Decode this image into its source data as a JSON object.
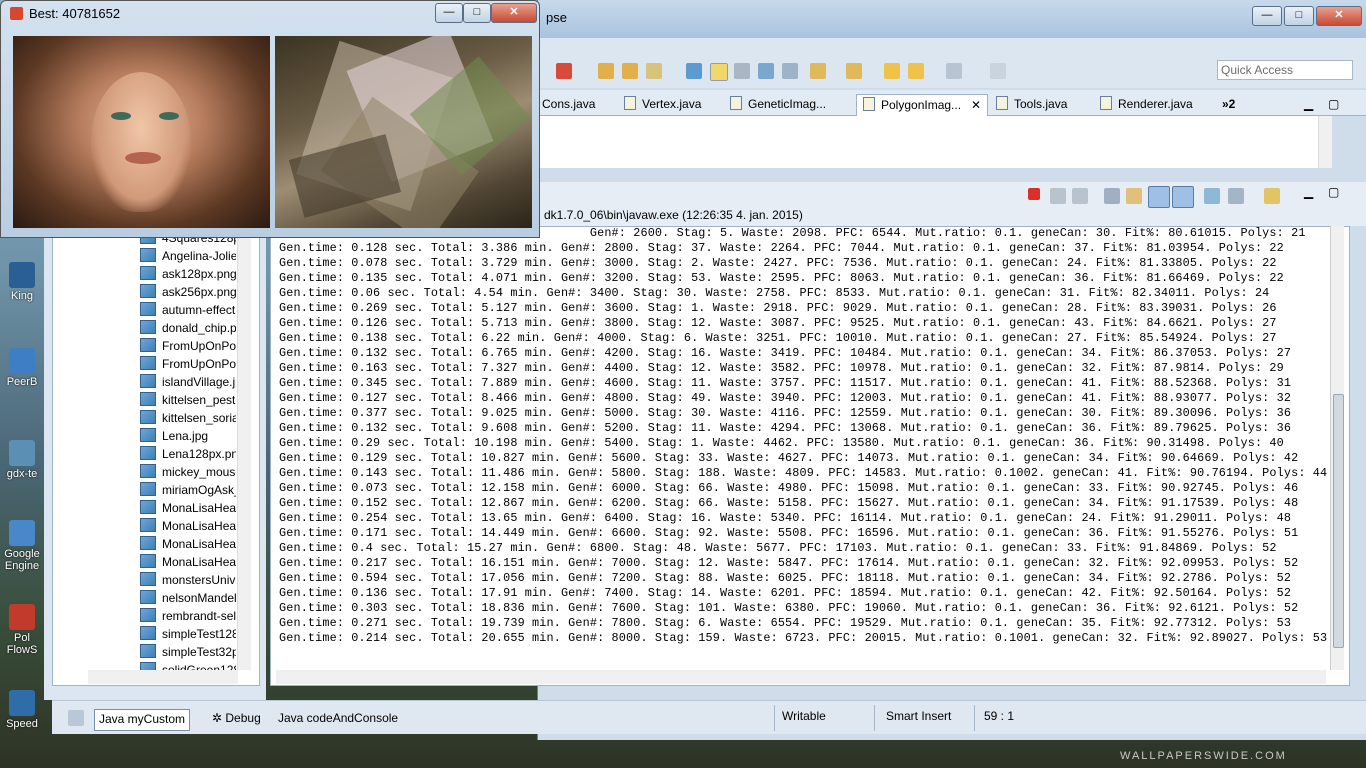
{
  "desktop": {
    "icons": [
      {
        "label": "King",
        "icon": "app-icon"
      },
      {
        "label": "PeerB",
        "icon": "app-icon"
      },
      {
        "label": "gdx-te",
        "icon": "app-icon"
      },
      {
        "label": "Google Engine",
        "icon": "app-icon"
      },
      {
        "label": "Pol FlowS",
        "icon": "app-icon"
      },
      {
        "label": "Speed",
        "icon": "app-icon"
      }
    ],
    "watermark": "WALLPAPERSWIDE.COM"
  },
  "image_window": {
    "title": "Best: 40781652",
    "buttons": {
      "minimize": "—",
      "maximize": "□",
      "close": "✕"
    }
  },
  "eclipse": {
    "title_fragment": "pse",
    "window_buttons": {
      "minimize": "—",
      "maximize": "□",
      "close": "✕"
    },
    "quick_access_placeholder": "Quick Access",
    "editor_tabs": [
      {
        "label": "Cons.java",
        "active": false
      },
      {
        "label": "Vertex.java",
        "active": false
      },
      {
        "label": "GeneticImag...",
        "active": false
      },
      {
        "label": "PolygonImag...",
        "active": true
      },
      {
        "label": "Tools.java",
        "active": false
      },
      {
        "label": "Renderer.java",
        "active": false
      }
    ],
    "tabs_overflow": "»2",
    "console_path": "dk1.7.0_06\\bin\\javaw.exe (12:26:35 4. jan. 2015)",
    "console_lines": [
      "                                           Gen#: 2600. Stag: 5. Waste: 2098. PFC: 6544. Mut.ratio: 0.1. geneCan: 30. Fit%: 80.61015. Polys: 21",
      "Gen.time: 0.128 sec. Total: 3.386 min. Gen#: 2800. Stag: 37. Waste: 2264. PFC: 7044. Mut.ratio: 0.1. geneCan: 37. Fit%: 81.03954. Polys: 22",
      "Gen.time: 0.078 sec. Total: 3.729 min. Gen#: 3000. Stag: 2. Waste: 2427. PFC: 7536. Mut.ratio: 0.1. geneCan: 24. Fit%: 81.33805. Polys: 22",
      "Gen.time: 0.135 sec. Total: 4.071 min. Gen#: 3200. Stag: 53. Waste: 2595. PFC: 8063. Mut.ratio: 0.1. geneCan: 36. Fit%: 81.66469. Polys: 22",
      "Gen.time: 0.06 sec. Total: 4.54 min. Gen#: 3400. Stag: 30. Waste: 2758. PFC: 8533. Mut.ratio: 0.1. geneCan: 31. Fit%: 82.34011. Polys: 24",
      "Gen.time: 0.269 sec. Total: 5.127 min. Gen#: 3600. Stag: 1. Waste: 2918. PFC: 9029. Mut.ratio: 0.1. geneCan: 28. Fit%: 83.39031. Polys: 26",
      "Gen.time: 0.126 sec. Total: 5.713 min. Gen#: 3800. Stag: 12. Waste: 3087. PFC: 9525. Mut.ratio: 0.1. geneCan: 43. Fit%: 84.6621. Polys: 27",
      "Gen.time: 0.138 sec. Total: 6.22 min. Gen#: 4000. Stag: 6. Waste: 3251. PFC: 10010. Mut.ratio: 0.1. geneCan: 27. Fit%: 85.54924. Polys: 27",
      "Gen.time: 0.132 sec. Total: 6.765 min. Gen#: 4200. Stag: 16. Waste: 3419. PFC: 10484. Mut.ratio: 0.1. geneCan: 34. Fit%: 86.37053. Polys: 27",
      "Gen.time: 0.163 sec. Total: 7.327 min. Gen#: 4400. Stag: 12. Waste: 3582. PFC: 10978. Mut.ratio: 0.1. geneCan: 32. Fit%: 87.9814. Polys: 29",
      "Gen.time: 0.345 sec. Total: 7.889 min. Gen#: 4600. Stag: 11. Waste: 3757. PFC: 11517. Mut.ratio: 0.1. geneCan: 41. Fit%: 88.52368. Polys: 31",
      "Gen.time: 0.127 sec. Total: 8.466 min. Gen#: 4800. Stag: 49. Waste: 3940. PFC: 12003. Mut.ratio: 0.1. geneCan: 41. Fit%: 88.93077. Polys: 32",
      "Gen.time: 0.377 sec. Total: 9.025 min. Gen#: 5000. Stag: 30. Waste: 4116. PFC: 12559. Mut.ratio: 0.1. geneCan: 30. Fit%: 89.30096. Polys: 36",
      "Gen.time: 0.132 sec. Total: 9.608 min. Gen#: 5200. Stag: 11. Waste: 4294. PFC: 13068. Mut.ratio: 0.1. geneCan: 36. Fit%: 89.79625. Polys: 36",
      "Gen.time: 0.29 sec. Total: 10.198 min. Gen#: 5400. Stag: 1. Waste: 4462. PFC: 13580. Mut.ratio: 0.1. geneCan: 36. Fit%: 90.31498. Polys: 40",
      "Gen.time: 0.129 sec. Total: 10.827 min. Gen#: 5600. Stag: 33. Waste: 4627. PFC: 14073. Mut.ratio: 0.1. geneCan: 34. Fit%: 90.64669. Polys: 42",
      "Gen.time: 0.143 sec. Total: 11.486 min. Gen#: 5800. Stag: 188. Waste: 4809. PFC: 14583. Mut.ratio: 0.1002. geneCan: 41. Fit%: 90.76194. Polys: 44",
      "Gen.time: 0.073 sec. Total: 12.158 min. Gen#: 6000. Stag: 66. Waste: 4980. PFC: 15098. Mut.ratio: 0.1. geneCan: 33. Fit%: 90.92745. Polys: 46",
      "Gen.time: 0.152 sec. Total: 12.867 min. Gen#: 6200. Stag: 66. Waste: 5158. PFC: 15627. Mut.ratio: 0.1. geneCan: 34. Fit%: 91.17539. Polys: 48",
      "Gen.time: 0.254 sec. Total: 13.65 min. Gen#: 6400. Stag: 16. Waste: 5340. PFC: 16114. Mut.ratio: 0.1. geneCan: 24. Fit%: 91.29011. Polys: 48",
      "Gen.time: 0.171 sec. Total: 14.449 min. Gen#: 6600. Stag: 92. Waste: 5508. PFC: 16596. Mut.ratio: 0.1. geneCan: 36. Fit%: 91.55276. Polys: 51",
      "Gen.time: 0.4 sec. Total: 15.27 min. Gen#: 6800. Stag: 48. Waste: 5677. PFC: 17103. Mut.ratio: 0.1. geneCan: 33. Fit%: 91.84869. Polys: 52",
      "Gen.time: 0.217 sec. Total: 16.151 min. Gen#: 7000. Stag: 12. Waste: 5847. PFC: 17614. Mut.ratio: 0.1. geneCan: 32. Fit%: 92.09953. Polys: 52",
      "Gen.time: 0.594 sec. Total: 17.056 min. Gen#: 7200. Stag: 88. Waste: 6025. PFC: 18118. Mut.ratio: 0.1. geneCan: 34. Fit%: 92.2786. Polys: 52",
      "Gen.time: 0.136 sec. Total: 17.91 min. Gen#: 7400. Stag: 14. Waste: 6201. PFC: 18594. Mut.ratio: 0.1. geneCan: 42. Fit%: 92.50164. Polys: 52",
      "Gen.time: 0.303 sec. Total: 18.836 min. Gen#: 7600. Stag: 101. Waste: 6380. PFC: 19060. Mut.ratio: 0.1. geneCan: 36. Fit%: 92.6121. Polys: 52",
      "Gen.time: 0.271 sec. Total: 19.739 min. Gen#: 7800. Stag: 6. Waste: 6554. PFC: 19529. Mut.ratio: 0.1. geneCan: 35. Fit%: 92.77312. Polys: 53",
      "Gen.time: 0.214 sec. Total: 20.655 min. Gen#: 8000. Stag: 159. Waste: 6723. PFC: 20015. Mut.ratio: 0.1001. geneCan: 32. Fit%: 92.89027. Polys: 53"
    ],
    "explorer_files": [
      "4Squares128px",
      "Angelina-Jolie_",
      "ask128px.png",
      "ask256px.png",
      "autumn-effect",
      "donald_chip.p",
      "FromUpOnPop",
      "FromUpOnPop",
      "islandVillage.jp",
      "kittelsen_pesta",
      "kittelsen_soria",
      "Lena.jpg",
      "Lena128px.png",
      "mickey_mouse",
      "miriamOgAsk_",
      "MonaLisaHead",
      "MonaLisaHead",
      "MonaLisaHead",
      "MonaLisaHead",
      "monstersUnive",
      "nelsonMandel",
      "rembrandt-sel",
      "simpleTest128",
      "simpleTest32p",
      "solidGreen128"
    ],
    "status_bar": {
      "perspectives": [
        {
          "label": "Java myCustom",
          "active": true
        },
        {
          "label": "Debug",
          "active": false
        },
        {
          "label": "Java codeAndConsole",
          "active": false
        }
      ],
      "writable": "Writable",
      "insert_mode": "Smart Insert",
      "position": "59 : 1"
    }
  },
  "colors": {
    "accent": "#3f7fb4",
    "terminate": "#d9302a"
  }
}
